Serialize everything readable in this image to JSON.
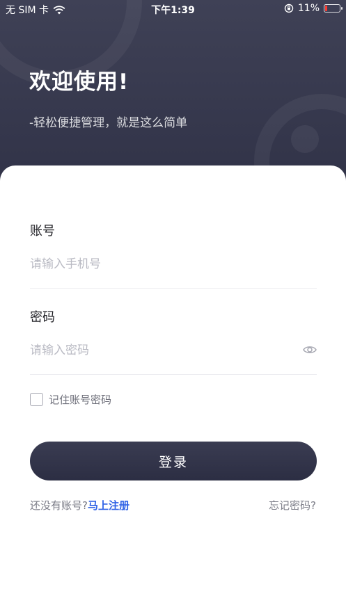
{
  "status_bar": {
    "carrier": "无 SIM 卡",
    "time": "下午1:39",
    "battery": "11%",
    "icons": [
      "wifi-icon",
      "orientation-lock-icon",
      "battery-icon"
    ]
  },
  "hero": {
    "title": "欢迎使用!",
    "subtitle": "-轻松便捷管理，就是这么简单"
  },
  "form": {
    "account": {
      "label": "账号",
      "placeholder": "请输入手机号",
      "value": ""
    },
    "password": {
      "label": "密码",
      "placeholder": "请输入密码",
      "value": ""
    },
    "remember_label": "记住账号密码",
    "remember_checked": false,
    "login_label": "登录"
  },
  "footer": {
    "no_account_text": "还没有账号?",
    "register_link": "马上注册",
    "forgot_link": "忘记密码?"
  },
  "colors": {
    "hero_bg": "#3a3c52",
    "button_bg": "#2f3146",
    "link": "#2f62e6",
    "battery_low": "#ff3b30"
  }
}
